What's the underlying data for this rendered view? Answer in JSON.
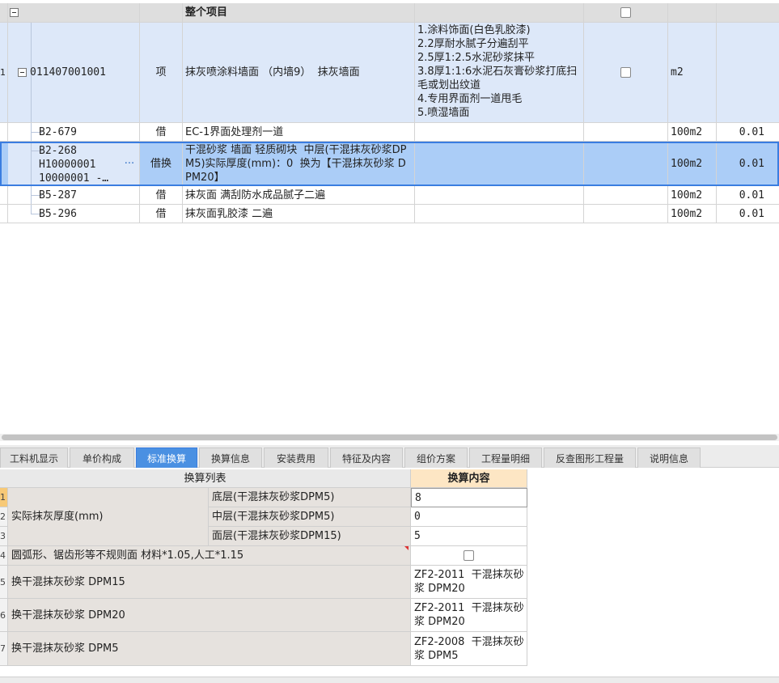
{
  "grid": {
    "header": {
      "title": "整个项目"
    },
    "item": {
      "code": "011407001001",
      "type": "项",
      "name": "抹灰喷涂料墙面 （内墙9）  抹灰墙面",
      "features": "1.涂料饰面(白色乳胶漆)\n2.2厚耐水腻子分遍刮平\n2.5厚1:2.5水泥砂浆抹平\n3.8厚1:1:6水泥石灰膏砂浆打底扫毛或划出纹道\n4.专用界面剂一道甩毛\n5.喷湿墙面",
      "unit": "m2"
    },
    "sub_rows": [
      {
        "code": "B2-679",
        "type": "借",
        "name": "EC-1界面处理剂一道",
        "unit": "100m2",
        "qty": "0.01"
      },
      {
        "code": "B2-268\nH10000001\n10000001 -…",
        "more": "···",
        "type": "借换",
        "name": "干混砂浆 墙面 轻质砌块  中层(干混抹灰砂浆DPM5)实际厚度(mm)：0  换为【干混抹灰砂浆 DPM20】",
        "unit": "100m2",
        "qty": "0.01"
      },
      {
        "code": "B5-287",
        "type": "借",
        "name": "抹灰面 满刮防水成品腻子二遍",
        "unit": "100m2",
        "qty": "0.01"
      },
      {
        "code": "B5-296",
        "type": "借",
        "name": "抹灰面乳胶漆 二遍",
        "unit": "100m2",
        "qty": "0.01"
      }
    ],
    "left_row_markers": [
      "1"
    ]
  },
  "tabs": [
    {
      "label": "工料机显示",
      "active": false
    },
    {
      "label": "单价构成",
      "active": false
    },
    {
      "label": "标准换算",
      "active": true
    },
    {
      "label": "换算信息",
      "active": false
    },
    {
      "label": "安装费用",
      "active": false
    },
    {
      "label": "特征及内容",
      "active": false
    },
    {
      "label": "组价方案",
      "active": false
    },
    {
      "label": "工程量明细",
      "active": false
    },
    {
      "label": "反查图形工程量",
      "active": false
    },
    {
      "label": "说明信息",
      "active": false
    }
  ],
  "conversion": {
    "header_list": "换算列表",
    "header_content": "换算内容",
    "group_label": "实际抹灰厚度(mm)",
    "rows": [
      {
        "num": "1",
        "label": "底层(干混抹灰砂浆DPM5)",
        "value": "8"
      },
      {
        "num": "2",
        "label": "中层(干混抹灰砂浆DPM5)",
        "value": "0"
      },
      {
        "num": "3",
        "label": "面层(干混抹灰砂浆DPM15)",
        "value": "5"
      },
      {
        "num": "4",
        "label": "圆弧形、锯齿形等不规则面 材料*1.05,人工*1.15",
        "value": ""
      },
      {
        "num": "5",
        "label": "换干混抹灰砂浆 DPM15",
        "value": "ZF2-2011  干混抹灰砂浆 DPM20"
      },
      {
        "num": "6",
        "label": "换干混抹灰砂浆 DPM20",
        "value": "ZF2-2011  干混抹灰砂浆 DPM20"
      },
      {
        "num": "7",
        "label": "换干混抹灰砂浆 DPM5",
        "value": "ZF2-2008  干混抹灰砂浆 DPM5"
      }
    ],
    "row4_checked": false
  },
  "colors": {
    "selected_row": "#abcdf7",
    "item_row": "#dde8f9",
    "active_tab": "#4a90e2",
    "header_accent": "#fde6c4"
  }
}
